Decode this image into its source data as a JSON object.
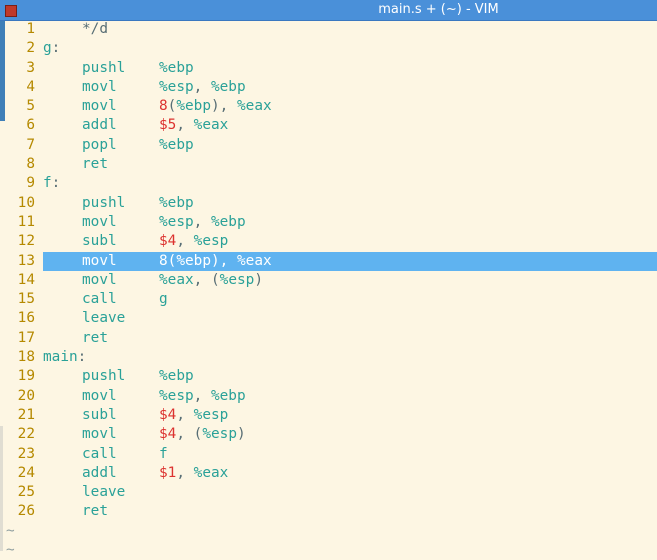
{
  "window": {
    "title": "main.s + (~) - VIM"
  },
  "lines": [
    {
      "n": "1",
      "comment": "*/d"
    },
    {
      "n": "2",
      "label": "g"
    },
    {
      "n": "3",
      "instr": "pushl",
      "ops": [
        [
          "reg",
          "%ebp"
        ]
      ]
    },
    {
      "n": "4",
      "instr": "movl",
      "ops": [
        [
          "reg",
          "%esp"
        ],
        [
          "plain",
          ", "
        ],
        [
          "reg",
          "%ebp"
        ]
      ]
    },
    {
      "n": "5",
      "instr": "movl",
      "ops": [
        [
          "imm",
          "8"
        ],
        [
          "plain",
          "("
        ],
        [
          "reg",
          "%ebp"
        ],
        [
          "plain",
          "), "
        ],
        [
          "reg",
          "%eax"
        ]
      ]
    },
    {
      "n": "6",
      "instr": "addl",
      "ops": [
        [
          "imm",
          "$5"
        ],
        [
          "plain",
          ", "
        ],
        [
          "reg",
          "%eax"
        ]
      ]
    },
    {
      "n": "7",
      "instr": "popl",
      "ops": [
        [
          "reg",
          "%ebp"
        ]
      ]
    },
    {
      "n": "8",
      "instr": "ret",
      "ops": []
    },
    {
      "n": "9",
      "label": "f"
    },
    {
      "n": "10",
      "instr": "pushl",
      "ops": [
        [
          "reg",
          "%ebp"
        ]
      ]
    },
    {
      "n": "11",
      "instr": "movl",
      "ops": [
        [
          "reg",
          "%esp"
        ],
        [
          "plain",
          ", "
        ],
        [
          "reg",
          "%ebp"
        ]
      ]
    },
    {
      "n": "12",
      "instr": "subl",
      "ops": [
        [
          "imm",
          "$4"
        ],
        [
          "plain",
          ", "
        ],
        [
          "reg",
          "%esp"
        ]
      ]
    },
    {
      "n": "13",
      "instr": "movl",
      "ops": [
        [
          "imm",
          "8"
        ],
        [
          "plain",
          "("
        ],
        [
          "reg",
          "%ebp"
        ],
        [
          "plain",
          "), "
        ],
        [
          "reg",
          "%eax"
        ]
      ],
      "current": true
    },
    {
      "n": "14",
      "instr": "movl",
      "ops": [
        [
          "reg",
          "%eax"
        ],
        [
          "plain",
          ", ("
        ],
        [
          "reg",
          "%esp"
        ],
        [
          "plain",
          ")"
        ]
      ]
    },
    {
      "n": "15",
      "instr": "call",
      "ops": [
        [
          "reg",
          "g"
        ]
      ]
    },
    {
      "n": "16",
      "instr": "leave",
      "ops": []
    },
    {
      "n": "17",
      "instr": "ret",
      "ops": []
    },
    {
      "n": "18",
      "label": "main"
    },
    {
      "n": "19",
      "instr": "pushl",
      "ops": [
        [
          "reg",
          "%ebp"
        ]
      ]
    },
    {
      "n": "20",
      "instr": "movl",
      "ops": [
        [
          "reg",
          "%esp"
        ],
        [
          "plain",
          ", "
        ],
        [
          "reg",
          "%ebp"
        ]
      ]
    },
    {
      "n": "21",
      "instr": "subl",
      "ops": [
        [
          "imm",
          "$4"
        ],
        [
          "plain",
          ", "
        ],
        [
          "reg",
          "%esp"
        ]
      ]
    },
    {
      "n": "22",
      "instr": "movl",
      "ops": [
        [
          "imm",
          "$4"
        ],
        [
          "plain",
          ", ("
        ],
        [
          "reg",
          "%esp"
        ],
        [
          "plain",
          ")"
        ]
      ]
    },
    {
      "n": "23",
      "instr": "call",
      "ops": [
        [
          "reg",
          "f"
        ]
      ]
    },
    {
      "n": "24",
      "instr": "addl",
      "ops": [
        [
          "imm",
          "$1"
        ],
        [
          "plain",
          ", "
        ],
        [
          "reg",
          "%eax"
        ]
      ]
    },
    {
      "n": "25",
      "instr": "leave",
      "ops": []
    },
    {
      "n": "26",
      "instr": "ret",
      "ops": []
    }
  ],
  "empty_markers": [
    "~",
    "~"
  ],
  "colors": {
    "background": "#fdf6e3",
    "line_number": "#b58900",
    "keyword": "#2aa198",
    "immediate": "#dc322f",
    "cursorline": "#5fb3f0",
    "titlebar": "#4a90d9"
  }
}
